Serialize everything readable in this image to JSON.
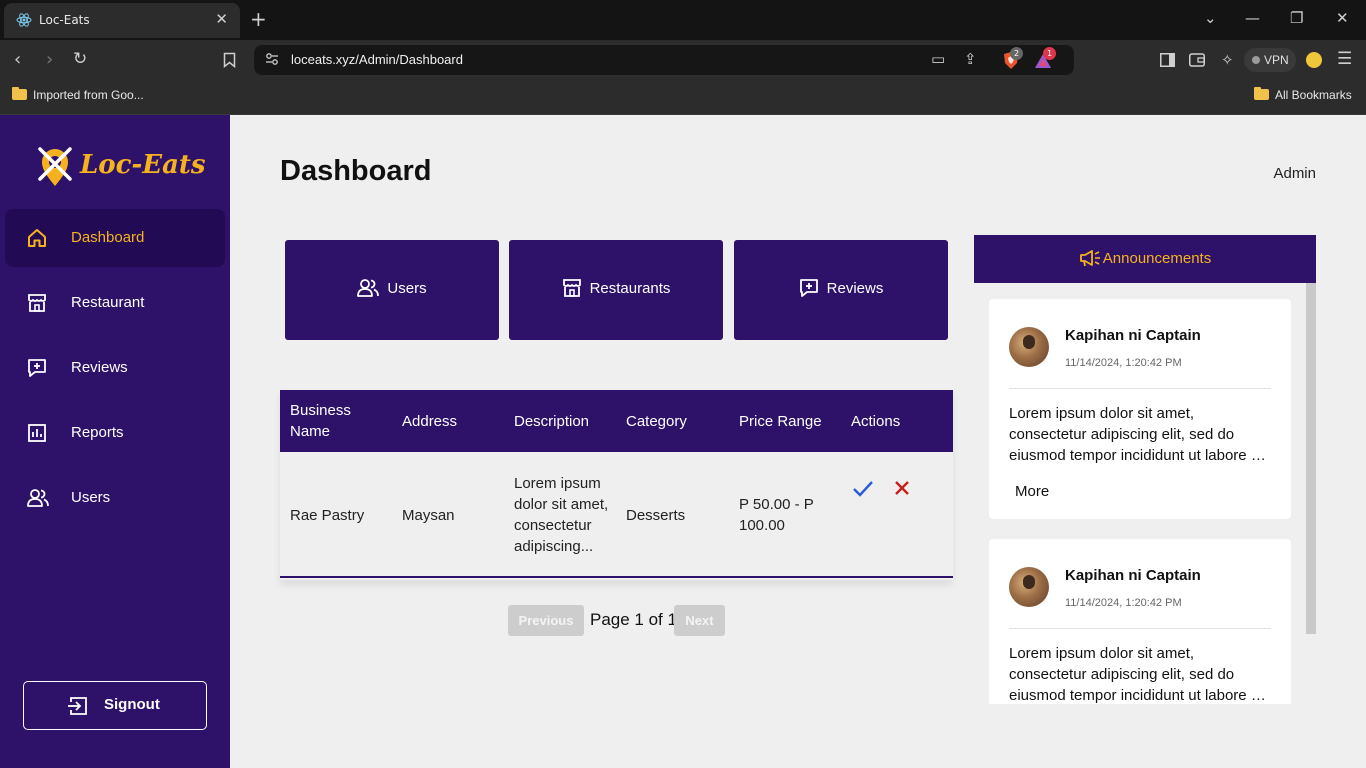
{
  "browser": {
    "tab_title": "Loc-Eats",
    "url": "loceats.xyz/Admin/Dashboard",
    "vpn_label": "VPN",
    "brave_badge": "2",
    "alert_badge": "1",
    "bookmarks": {
      "imported": "Imported from Goo...",
      "all": "All Bookmarks"
    }
  },
  "sidebar": {
    "logo_text": "Loc-Eats",
    "items": [
      {
        "label": "Dashboard",
        "icon": "home-icon",
        "active": true
      },
      {
        "label": "Restaurant",
        "icon": "store-icon"
      },
      {
        "label": "Reviews",
        "icon": "review-icon"
      },
      {
        "label": "Reports",
        "icon": "chart-icon"
      },
      {
        "label": "Users",
        "icon": "users-icon"
      }
    ],
    "signout_label": "Signout"
  },
  "header": {
    "title": "Dashboard",
    "user": "Admin"
  },
  "cards": [
    {
      "label": "Users",
      "icon": "users-icon"
    },
    {
      "label": "Restaurants",
      "icon": "store-icon"
    },
    {
      "label": "Reviews",
      "icon": "review-icon"
    }
  ],
  "table": {
    "headers": [
      "Business Name",
      "Address",
      "Description",
      "Category",
      "Price Range",
      "Actions"
    ],
    "rows": [
      {
        "business_name": "Rae Pastry",
        "address": "Maysan",
        "description": "Lorem ipsum dolor sit amet, consectetur adipiscing...",
        "category": "Desserts",
        "price_range": "P 50.00 - P 100.00"
      }
    ]
  },
  "pagination": {
    "previous": "Previous",
    "page_text": "Page 1 of 1",
    "next": "Next"
  },
  "announcements": {
    "title": "Announcements",
    "items": [
      {
        "author": "Kapihan ni Captain",
        "date": "11/14/2024, 1:20:42 PM",
        "body": "Lorem ipsum dolor sit amet, consectetur adipiscing elit, sed do eiusmod tempor incididunt ut labore et dolore magna aliqua.",
        "more": "More"
      },
      {
        "author": "Kapihan ni Captain",
        "date": "11/14/2024, 1:20:42 PM",
        "body": "Lorem ipsum dolor sit amet, consectetur adipiscing elit, sed do eiusmod tempor incididunt ut labore et dolore magna aliqua."
      }
    ]
  },
  "colors": {
    "brand": "#2e1169",
    "accent": "#f6b21e",
    "approve": "#2a5bd7",
    "reject": "#c91d1d"
  }
}
